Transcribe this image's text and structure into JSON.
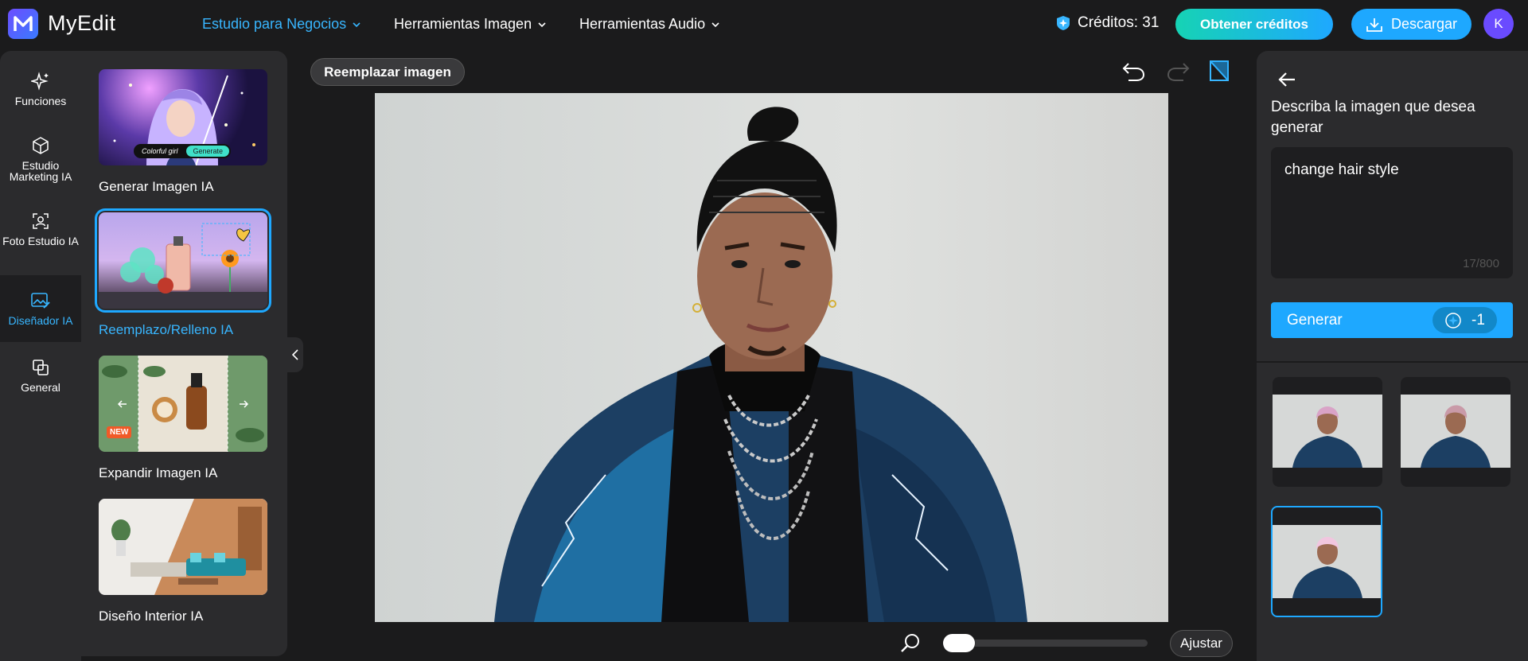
{
  "app": {
    "name": "MyEdit"
  },
  "nav": [
    {
      "label": "Estudio para Negocios",
      "active": true
    },
    {
      "label": "Herramientas Imagen",
      "active": false
    },
    {
      "label": "Herramientas Audio",
      "active": false
    }
  ],
  "header": {
    "credits_label": "Créditos: 31",
    "obtain_label": "Obtener créditos",
    "download_label": "Descargar",
    "avatar_initial": "K"
  },
  "rail": [
    {
      "label": "Funciones",
      "icon": "sparkle-icon",
      "active": false
    },
    {
      "label": "Estudio Marketing IA",
      "icon": "box-icon",
      "active": false
    },
    {
      "label": "Foto Estudio IA",
      "icon": "portrait-scan-icon",
      "active": false
    },
    {
      "label": "Diseñador IA",
      "icon": "image-edit-icon",
      "active": true
    },
    {
      "label": "General",
      "icon": "layers-icon",
      "active": false
    }
  ],
  "tools": [
    {
      "label": "Generar Imagen IA",
      "active": false,
      "overlay_text": "Colorful girl",
      "overlay_button": "Generate"
    },
    {
      "label": "Reemplazo/Relleno IA",
      "active": true
    },
    {
      "label": "Expandir Imagen IA",
      "active": false,
      "badge": "NEW"
    },
    {
      "label": "Diseño Interior IA",
      "active": false
    }
  ],
  "canvas": {
    "replace_label": "Reemplazar imagen",
    "fit_label": "Ajustar",
    "zoom_level": 0.0
  },
  "panel": {
    "prompt_title": "Describa la imagen que desea generar",
    "prompt_value": "change hair style",
    "char_count": "17/800",
    "generate_label": "Generar",
    "generate_cost": "-1"
  },
  "results": [
    {
      "selected": false
    },
    {
      "selected": false
    },
    {
      "selected": true
    }
  ],
  "colors": {
    "accent": "#1ea8ff",
    "active_text": "#38b6ff",
    "panel": "#2b2b2d",
    "background": "#1b1b1c"
  }
}
